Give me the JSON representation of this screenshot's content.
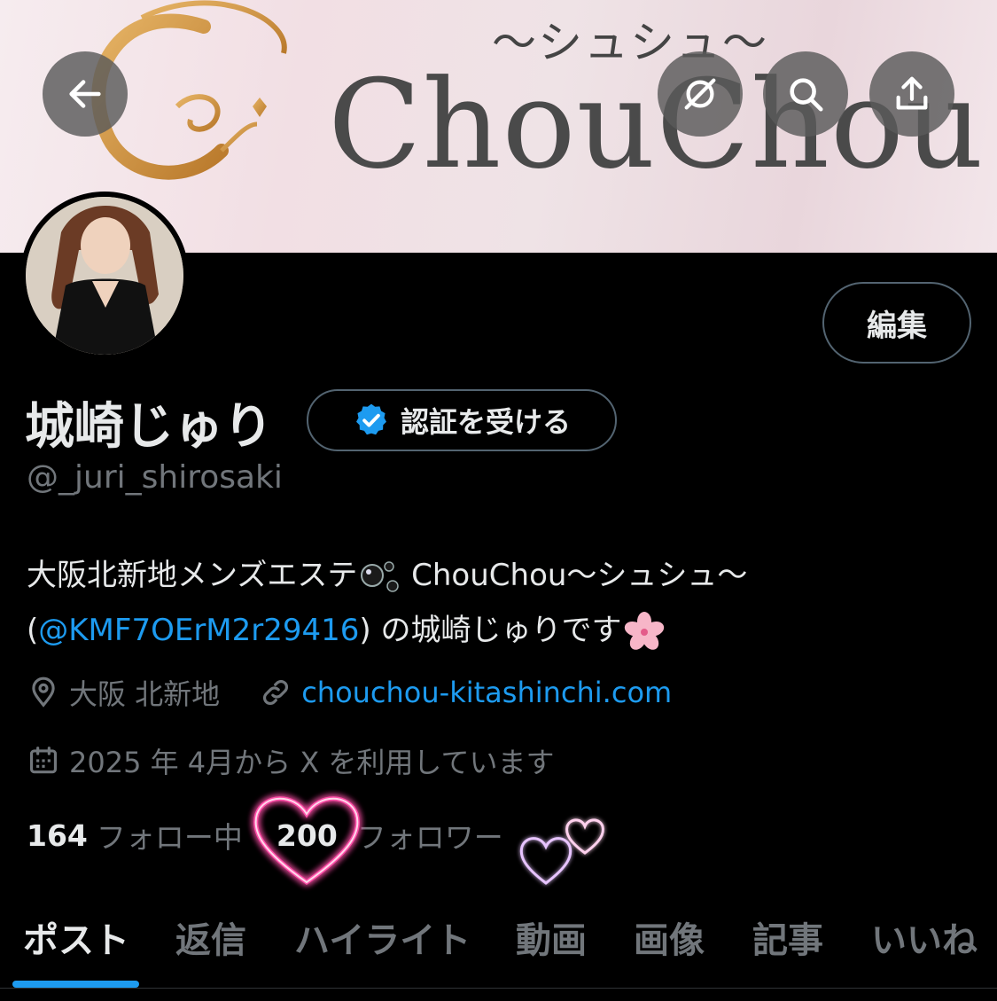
{
  "banner": {
    "subtitle": "〜シュシュ〜",
    "title": "ChouChou"
  },
  "toolbar": {
    "back_icon": "arrow-left-icon",
    "grok_icon": "grok-icon",
    "search_icon": "search-icon",
    "share_icon": "share-icon"
  },
  "profile": {
    "edit_label": "編集",
    "display_name": "城崎じゅり",
    "verify_label": "認証を受ける",
    "handle": "@_juri_shirosaki",
    "bio": {
      "line1_text": "大阪北新地メンズエステ",
      "line1_suffix": " ChouChou〜シュシュ〜",
      "line2_open": "(",
      "line2_mention": "@KMF7OErM2r29416",
      "line2_rest": ") の城崎じゅりです"
    },
    "location": "大阪 北新地",
    "website": "chouchou-kitashinchi.com",
    "joined": "2025 年 4月から X を利用しています",
    "following_count": "164",
    "following_label": "フォロー中",
    "followers_count": "200",
    "followers_label": "フォロワー"
  },
  "tabs": [
    {
      "label": "ポスト",
      "active": true
    },
    {
      "label": "返信"
    },
    {
      "label": "ハイライト"
    },
    {
      "label": "動画"
    },
    {
      "label": "画像"
    },
    {
      "label": "記事"
    },
    {
      "label": "いいね"
    }
  ],
  "colors": {
    "accent": "#1d9bf0",
    "muted": "#71767b",
    "heart_glow": "#ff4fa8"
  }
}
